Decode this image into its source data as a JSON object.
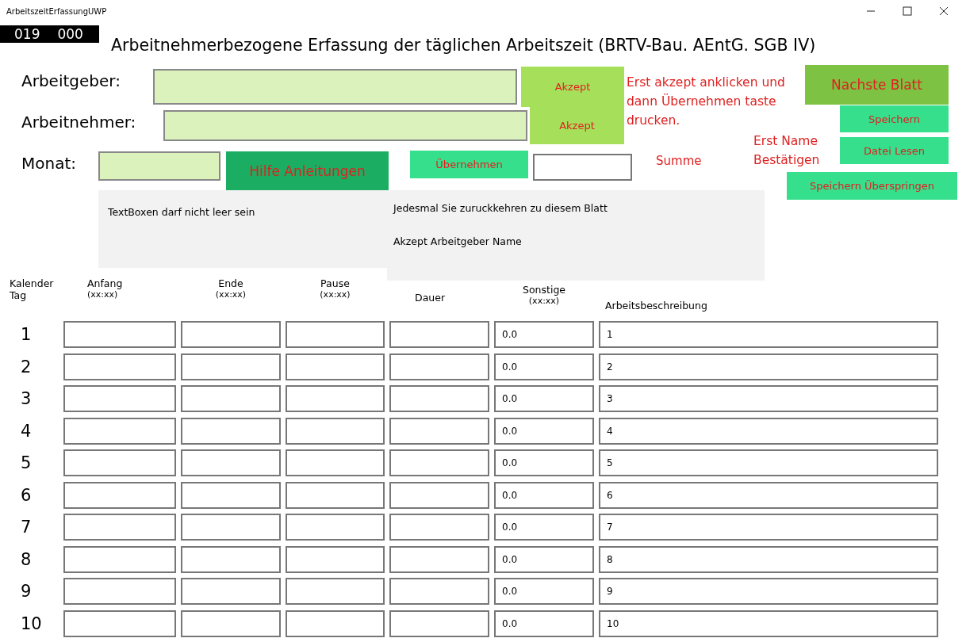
{
  "window": {
    "title": "ArbeitszeitErfassungUWP"
  },
  "counter": [
    "019",
    "000"
  ],
  "heading": "Arbeitnehmerbezogene Erfassung der täglichen Arbeitszeit (BRTV-Bau. AEntG. SGB IV)",
  "form": {
    "arbeitgeber_label": "Arbeitgeber:",
    "arbeitnehmer_label": "Arbeitnehmer:",
    "monat_label": "Monat:",
    "summe_label": "Summe"
  },
  "buttons": {
    "akzept_1": "Akzept",
    "akzept_2": "Akzept",
    "hilfe": "Hilfe Anleitungen",
    "uebernehmen": "Übernehmen",
    "nachste_blatt": "Nachste Blatt",
    "speichern": "Speichern",
    "datei_lesen": "Datei Lesen",
    "speichern_ueberspringen": "Speichern Überspringen"
  },
  "notes": {
    "akzept_hint": "Erst akzept anklicken und dann Übernehmen taste drucken.",
    "name_hint": "Erst Name Bestätigen"
  },
  "info_boxes": [
    {
      "lines": [
        "TextBoxen darf nicht leer sein"
      ]
    },
    {
      "lines": [
        "Jedesmal Sie zuruckkehren zu diesem Blatt",
        "Akzept Arbeitgeber Name"
      ]
    }
  ],
  "table": {
    "columns": [
      {
        "label": "Kalender Tag"
      },
      {
        "label": "Anfang",
        "hint": "(xx:xx)"
      },
      {
        "label": "Ende",
        "hint": "(xx:xx)"
      },
      {
        "label": "Pause",
        "hint": "(xx:xx)"
      },
      {
        "label": "Dauer"
      },
      {
        "label": "Sonstige",
        "hint": "(xx:xx)"
      },
      {
        "label": "Arbeitsbeschreibung"
      }
    ],
    "rows": [
      {
        "day": "1",
        "sonstige": "0.0",
        "beschreibung": "1"
      },
      {
        "day": "2",
        "sonstige": "0.0",
        "beschreibung": "2"
      },
      {
        "day": "3",
        "sonstige": "0.0",
        "beschreibung": "3"
      },
      {
        "day": "4",
        "sonstige": "0.0",
        "beschreibung": "4"
      },
      {
        "day": "5",
        "sonstige": "0.0",
        "beschreibung": "5"
      },
      {
        "day": "6",
        "sonstige": "0.0",
        "beschreibung": "6"
      },
      {
        "day": "7",
        "sonstige": "0.0",
        "beschreibung": "7"
      },
      {
        "day": "8",
        "sonstige": "0.0",
        "beschreibung": "8"
      },
      {
        "day": "9",
        "sonstige": "0.0",
        "beschreibung": "9"
      },
      {
        "day": "10",
        "sonstige": "0.0",
        "beschreibung": "10"
      }
    ]
  }
}
